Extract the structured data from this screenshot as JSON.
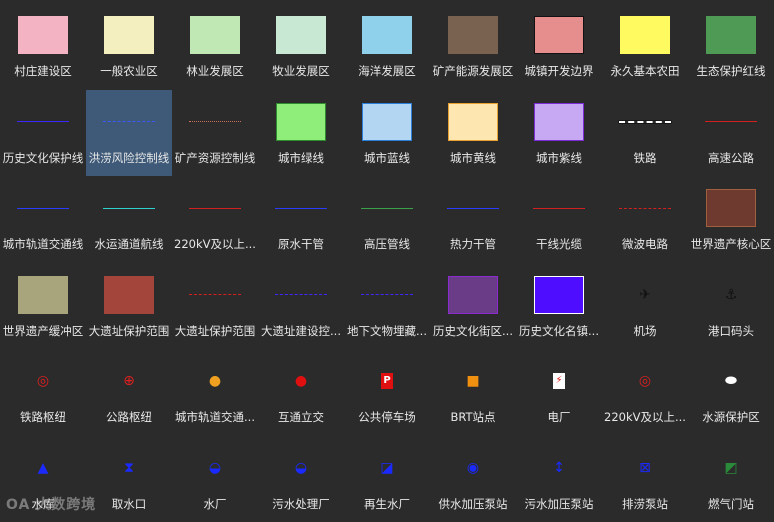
{
  "watermark": "OA 大数跨境",
  "items": [
    {
      "label": "村庄建设区",
      "kind": "swatch",
      "fill": "#f4b3c2"
    },
    {
      "label": "一般农业区",
      "kind": "swatch",
      "fill": "#f3efbf"
    },
    {
      "label": "林业发展区",
      "kind": "swatch",
      "fill": "#bfe8b4"
    },
    {
      "label": "牧业发展区",
      "kind": "swatch",
      "fill": "#c8e8d4"
    },
    {
      "label": "海洋发展区",
      "kind": "swatch",
      "fill": "#8fd0ea"
    },
    {
      "label": "矿产能源发展区",
      "kind": "swatch",
      "fill": "#7a6250"
    },
    {
      "label": "城镇开发边界",
      "kind": "swatch",
      "fill": "#e68e8e",
      "stroke": "#111111"
    },
    {
      "label": "永久基本农田",
      "kind": "swatch",
      "fill": "#fffa60"
    },
    {
      "label": "生态保护红线",
      "kind": "swatch",
      "fill": "#4f9b56"
    },
    {
      "label": "历史文化保护线",
      "kind": "line",
      "color": "#3b2aff",
      "style": "solid"
    },
    {
      "label": "洪涝风险控制线",
      "kind": "line",
      "color": "#3b5bff",
      "style": "dashdot",
      "selected": true
    },
    {
      "label": "矿产资源控制线",
      "kind": "line",
      "color": "#c8705a",
      "style": "dotted"
    },
    {
      "label": "城市绿线",
      "kind": "swatch",
      "fill": "#8fed7a",
      "stroke": "#2e8b2e"
    },
    {
      "label": "城市蓝线",
      "kind": "swatch",
      "fill": "#b3d7f3",
      "stroke": "#2c7fd8"
    },
    {
      "label": "城市黄线",
      "kind": "swatch",
      "fill": "#fde6b0",
      "stroke": "#e8a030"
    },
    {
      "label": "城市紫线",
      "kind": "swatch",
      "fill": "#c7a9f3",
      "stroke": "#7d2bd6"
    },
    {
      "label": "铁路",
      "kind": "line",
      "color": "#ffffff",
      "style": "rail"
    },
    {
      "label": "高速公路",
      "kind": "line",
      "color": "#d02020",
      "style": "solid"
    },
    {
      "label": "城市轨道交通线",
      "kind": "line",
      "color": "#2a3cff",
      "style": "solid"
    },
    {
      "label": "水运通道航线",
      "kind": "line",
      "color": "#2ed0d0",
      "style": "solid"
    },
    {
      "label": "220kV及以上...",
      "kind": "line",
      "color": "#d02020",
      "style": "solid"
    },
    {
      "label": "原水干管",
      "kind": "line",
      "color": "#2a3cff",
      "style": "solid"
    },
    {
      "label": "高压管线",
      "kind": "line",
      "color": "#3aa04a",
      "style": "solid"
    },
    {
      "label": "热力干管",
      "kind": "line",
      "color": "#2a3cff",
      "style": "solid"
    },
    {
      "label": "干线光缆",
      "kind": "line",
      "color": "#d02020",
      "style": "solid"
    },
    {
      "label": "微波电路",
      "kind": "line",
      "color": "#d02020",
      "style": "dashed"
    },
    {
      "label": "世界遗产核心区",
      "kind": "swatch",
      "fill": "#6e3a30",
      "stroke": "#a06040"
    },
    {
      "label": "世界遗产缓冲区",
      "kind": "swatch",
      "fill": "#a8a47c"
    },
    {
      "label": "大遗址保护范围",
      "kind": "swatch",
      "fill": "#a3453a"
    },
    {
      "label": "大遗址保护范围",
      "kind": "line",
      "color": "#d02020",
      "style": "dashed"
    },
    {
      "label": "大遗址建设控...",
      "kind": "line",
      "color": "#3b2aff",
      "style": "dashed"
    },
    {
      "label": "地下文物埋藏...",
      "kind": "line",
      "color": "#3b2aff",
      "style": "dashed"
    },
    {
      "label": "历史文化街区...",
      "kind": "swatch",
      "fill": "#6a3c88",
      "stroke": "#8a2bd0"
    },
    {
      "label": "历史文化名镇...",
      "kind": "swatch",
      "fill": "#4f0dff",
      "stroke": "#ffffff"
    },
    {
      "label": "机场",
      "kind": "glyph",
      "icon": "airplane-icon",
      "char": "✈",
      "color": "#111111"
    },
    {
      "label": "港口码头",
      "kind": "glyph",
      "icon": "anchor-icon",
      "char": "⚓",
      "color": "#111111"
    },
    {
      "label": "铁路枢纽",
      "kind": "glyph",
      "icon": "railway-hub-icon",
      "char": "◎",
      "color": "#e02020"
    },
    {
      "label": "公路枢纽",
      "kind": "glyph",
      "icon": "highway-hub-icon",
      "char": "⊕",
      "color": "#e02020"
    },
    {
      "label": "城市轨道交通...",
      "kind": "glyph",
      "icon": "metro-station-icon",
      "char": "●",
      "color": "#f0a020"
    },
    {
      "label": "互通立交",
      "kind": "glyph",
      "icon": "interchange-icon",
      "char": "●",
      "color": "#e01010"
    },
    {
      "label": "公共停车场",
      "kind": "glyph",
      "icon": "parking-icon",
      "char": "P",
      "color": "#ffffff",
      "bg": "#e01010"
    },
    {
      "label": "BRT站点",
      "kind": "glyph",
      "icon": "brt-station-icon",
      "char": "■",
      "color": "#f09010"
    },
    {
      "label": "电厂",
      "kind": "glyph",
      "icon": "power-plant-icon",
      "char": "⚡",
      "color": "#e01010",
      "bg": "#ffffff"
    },
    {
      "label": "220kV及以上...",
      "kind": "glyph",
      "icon": "substation-icon",
      "char": "◎",
      "color": "#e02020"
    },
    {
      "label": "水源保护区",
      "kind": "glyph",
      "icon": "water-source-icon",
      "char": "⬬",
      "color": "#ffffff"
    },
    {
      "label": "水库",
      "kind": "glyph",
      "icon": "reservoir-icon",
      "char": "▲",
      "color": "#1a2aff"
    },
    {
      "label": "取水口",
      "kind": "glyph",
      "icon": "water-intake-icon",
      "char": "⧗",
      "color": "#1a2aff"
    },
    {
      "label": "水厂",
      "kind": "glyph",
      "icon": "water-plant-icon",
      "char": "◒",
      "color": "#1a2aff"
    },
    {
      "label": "污水处理厂",
      "kind": "glyph",
      "icon": "sewage-plant-icon",
      "char": "◒",
      "color": "#1a2aff"
    },
    {
      "label": "再生水厂",
      "kind": "glyph",
      "icon": "reclaimed-water-plant-icon",
      "char": "◪",
      "color": "#1a2aff"
    },
    {
      "label": "供水加压泵站",
      "kind": "glyph",
      "icon": "water-supply-pump-icon",
      "char": "◉",
      "color": "#1a2aff"
    },
    {
      "label": "污水加压泵站",
      "kind": "glyph",
      "icon": "sewage-pump-icon",
      "char": "↕",
      "color": "#1a2aff"
    },
    {
      "label": "排涝泵站",
      "kind": "glyph",
      "icon": "drainage-pump-icon",
      "char": "⊠",
      "color": "#1a2aff"
    },
    {
      "label": "燃气门站",
      "kind": "glyph",
      "icon": "gas-station-icon",
      "char": "◩",
      "color": "#2a8a3a"
    }
  ]
}
